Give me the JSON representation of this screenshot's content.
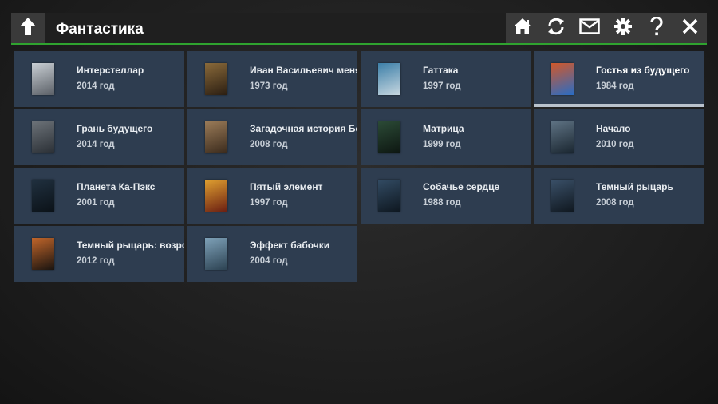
{
  "header": {
    "title": "Фантастика",
    "icons": [
      "back-arrow-icon",
      "home-icon",
      "refresh-icon",
      "mail-icon",
      "gear-icon",
      "help-icon",
      "close-icon"
    ],
    "accent_color": "#2fa32f"
  },
  "movies": [
    {
      "title": "Интерстеллар",
      "year": "2014 год",
      "poster_colors": [
        "#c9cfd4",
        "#5b6067"
      ]
    },
    {
      "title": "Иван Васильевич меняет профессию",
      "year": "1973 год",
      "poster_colors": [
        "#8a6a3a",
        "#2b1e12"
      ]
    },
    {
      "title": "Гаттака",
      "year": "1997 год",
      "poster_colors": [
        "#3c7fa8",
        "#c7d7e0"
      ]
    },
    {
      "title": "Гостья из будущего",
      "year": "1984 год",
      "poster_colors": [
        "#d2582a",
        "#2a6cc4"
      ]
    },
    {
      "title": "Грань будущего",
      "year": "2014 год",
      "poster_colors": [
        "#6c7278",
        "#2a2f35"
      ]
    },
    {
      "title": "Загадочная история Бенджамина Баттона",
      "year": "2008 год",
      "poster_colors": [
        "#9a7b58",
        "#3a2a1c"
      ]
    },
    {
      "title": "Матрица",
      "year": "1999 год",
      "poster_colors": [
        "#2b4a36",
        "#0d1611"
      ]
    },
    {
      "title": "Начало",
      "year": "2010 год",
      "poster_colors": [
        "#5e7283",
        "#1a2630"
      ]
    },
    {
      "title": "Планета Ка-Пэкс",
      "year": "2001 год",
      "poster_colors": [
        "#20303f",
        "#0b1218"
      ]
    },
    {
      "title": "Пятый элемент",
      "year": "1997 год",
      "poster_colors": [
        "#e0a030",
        "#6b1f12"
      ]
    },
    {
      "title": "Собачье сердце",
      "year": "1988 год",
      "poster_colors": [
        "#324b63",
        "#0e1720"
      ]
    },
    {
      "title": "Темный рыцарь",
      "year": "2008 год",
      "poster_colors": [
        "#3a5068",
        "#101820"
      ]
    },
    {
      "title": "Темный рыцарь: возрождение легенды",
      "year": "2012 год",
      "poster_colors": [
        "#c0652a",
        "#1a1410"
      ]
    },
    {
      "title": "Эффект бабочки",
      "year": "2004 год",
      "poster_colors": [
        "#7ea1b8",
        "#2c4252"
      ]
    }
  ],
  "selected_index": 3
}
